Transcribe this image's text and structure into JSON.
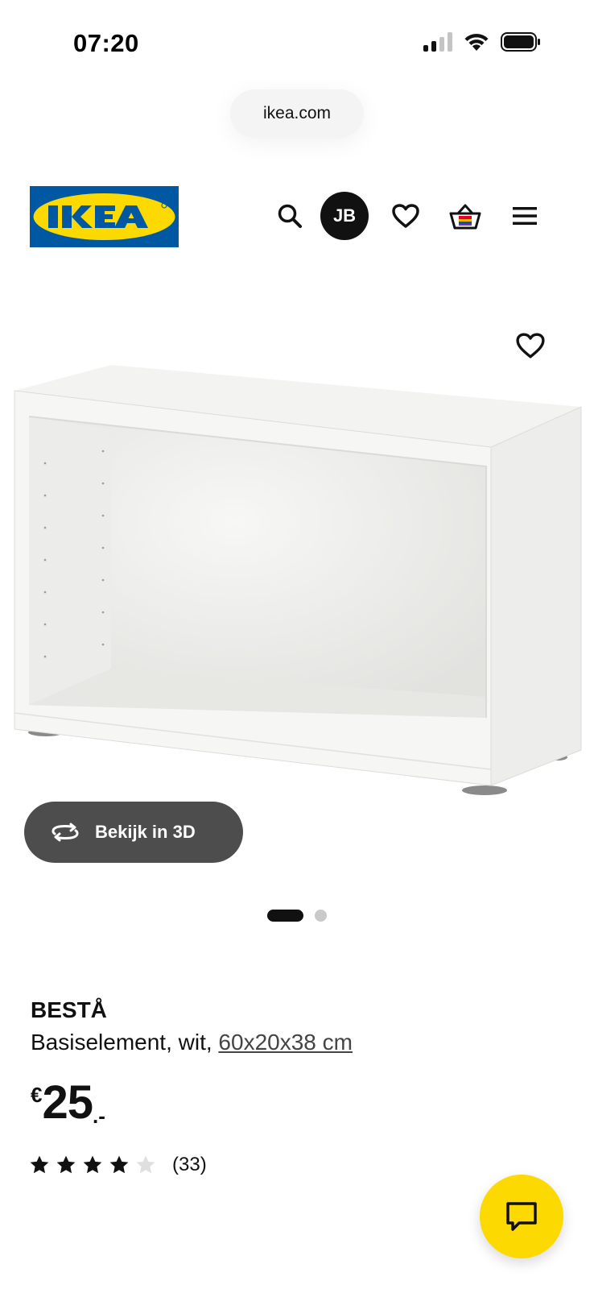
{
  "status_bar": {
    "time": "07:20",
    "icons": [
      "cellular-signal-icon",
      "wifi-icon",
      "battery-icon"
    ]
  },
  "browser": {
    "url": "ikea.com"
  },
  "header": {
    "logo_text": "IKEA",
    "icons": [
      "search-icon",
      "heart-icon",
      "shopping-basket-icon",
      "menu-icon"
    ],
    "avatar_initials": "JB"
  },
  "gallery": {
    "view_3d_label": "Bekijk in 3D",
    "view_3d_icon": "rotate-3d-icon",
    "favourite_icon": "heart-icon",
    "current_slide": 1,
    "total_slides": 2
  },
  "product": {
    "name": "BESTÅ",
    "description_prefix": "Basiselement, wit, ",
    "size_link": "60x20x38 cm",
    "price_currency": "€",
    "price_integer": "25",
    "price_decimal": ".-",
    "rating_value": 4,
    "rating_max": 5,
    "review_count": "(33)"
  },
  "chat": {
    "icon": "chat-bubble-icon"
  },
  "colors": {
    "ikea_blue": "#0058a3",
    "ikea_yellow": "#fcd900",
    "dark_button": "#4d4d4d",
    "text": "#111111"
  }
}
